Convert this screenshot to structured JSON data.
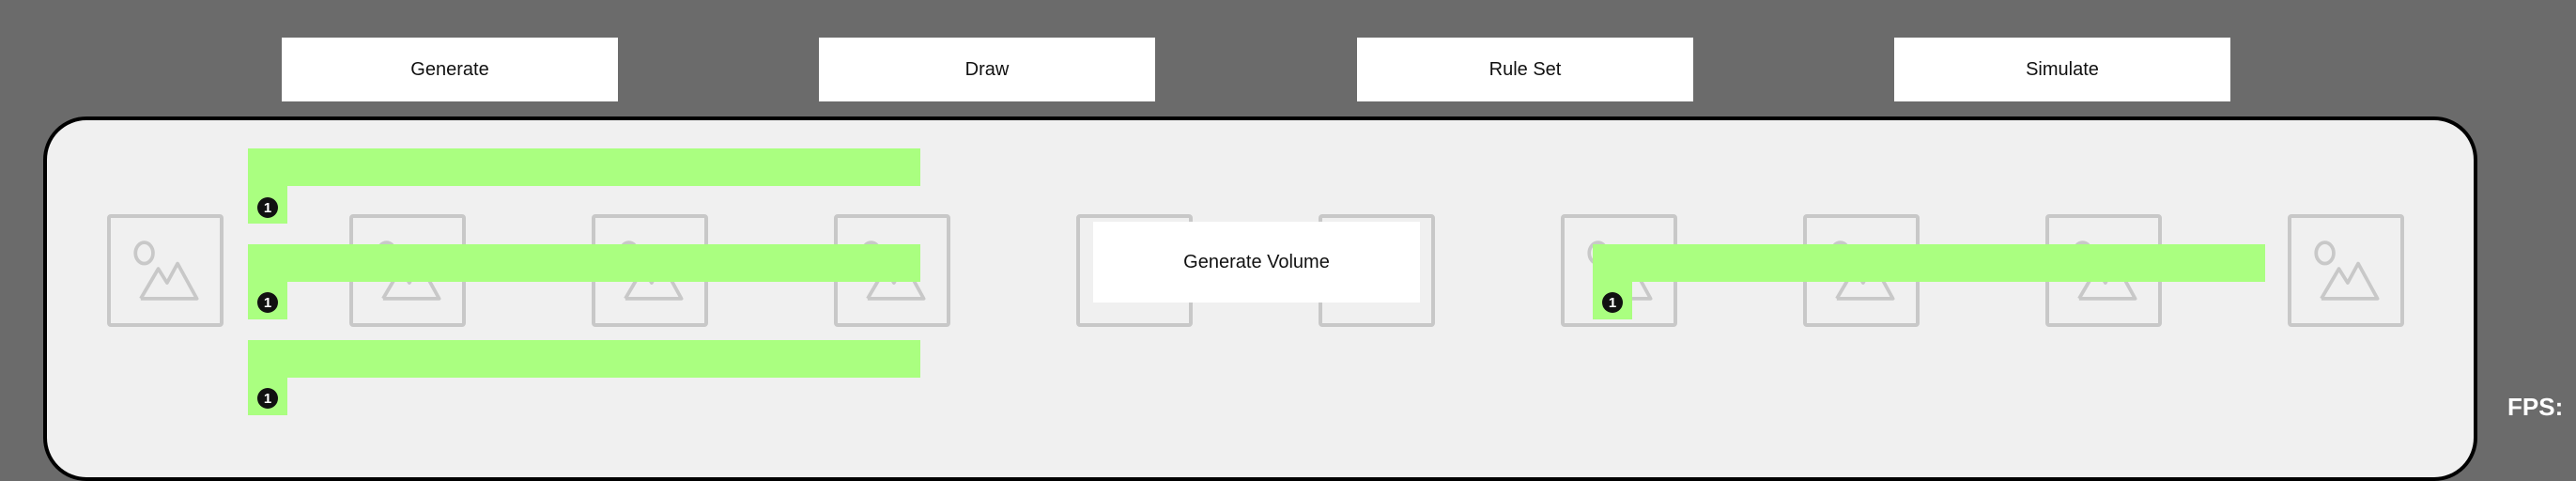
{
  "toolbar": {
    "generate_label": "Generate",
    "draw_label": "Draw",
    "rule_set_label": "Rule Set",
    "simulate_label": "Simulate"
  },
  "panel": {
    "generate_volume_label": "Generate Volume",
    "item_placeholders": [
      {
        "icon": "image-placeholder-icon"
      },
      {
        "icon": "image-placeholder-icon"
      },
      {
        "icon": "image-placeholder-icon"
      },
      {
        "icon": "image-placeholder-icon"
      },
      {
        "icon": "image-placeholder-icon"
      },
      {
        "icon": "image-placeholder-icon"
      },
      {
        "icon": "image-placeholder-icon"
      },
      {
        "icon": "image-placeholder-icon"
      },
      {
        "icon": "image-placeholder-icon"
      },
      {
        "icon": "image-placeholder-icon"
      }
    ],
    "tooltip_badges": [
      "1",
      "1",
      "1",
      "1"
    ]
  },
  "status": {
    "fps_label": "FPS:"
  },
  "colors": {
    "background": "#6b6b6b",
    "panel": "#f0f0f0",
    "highlight": "#aaff80",
    "placeholder_stroke": "#c8c8c8"
  }
}
